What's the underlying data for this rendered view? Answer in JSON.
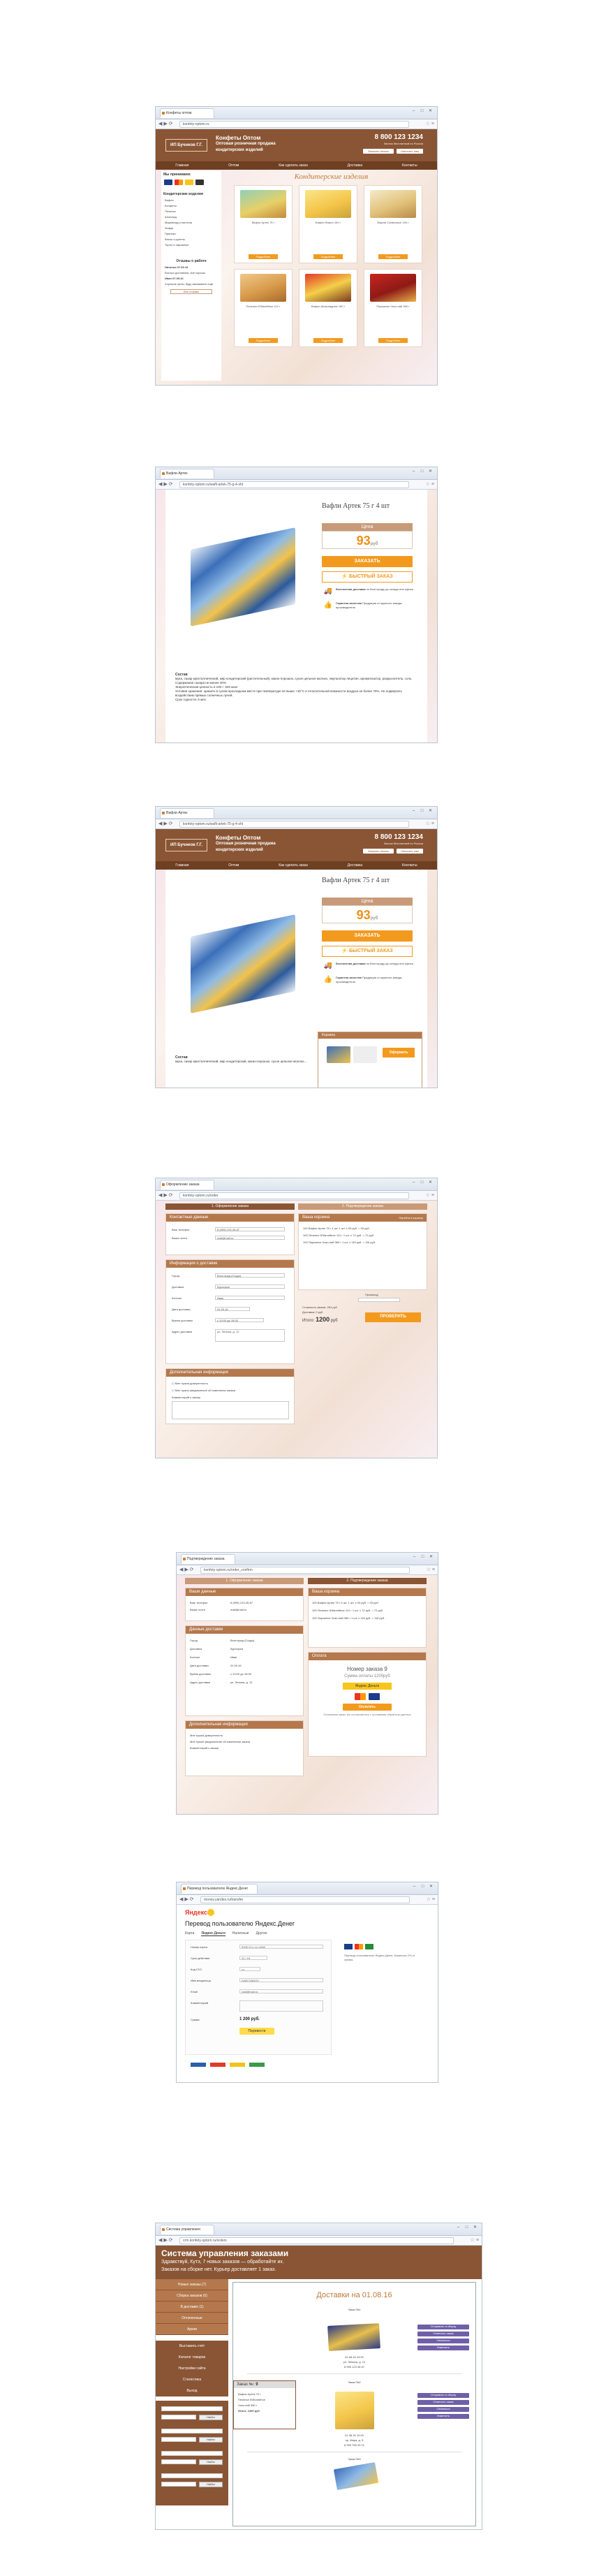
{
  "s1": {
    "tab": "Конфеты оптом",
    "url": "konfety-optom.ru",
    "logo": "ИП Бучнеов Г.Г.",
    "tagline1": "Конфеты Оптом",
    "tagline2": "Оптовая розничная продажа",
    "tagline3": "кондитерских изделий",
    "phone": "8 800 123 1234",
    "phone_sub": "Звонок бесплатный по России",
    "btn_callback": "Заказать звонок",
    "btn_mail": "Написать нам",
    "menu": [
      "Главная",
      "Оптом",
      "Как сделать заказ",
      "Доставка",
      "Контакты"
    ],
    "section_title": "Кондитерские изделия",
    "sidebar_head": "Мы принимаем:",
    "categories_head": "Кондитерские изделия",
    "categories": [
      "Вафли",
      "Конфеты",
      "Печенье",
      "Шоколад",
      "Мармелад и пастила",
      "Зефир",
      "Пряники",
      "Кексы и рулеты",
      "Торты и пирожные"
    ],
    "reviews_head": "Отзывы о работе",
    "reviews": [
      "Наталья 07.09.16",
      "Быстро доставили, всё хорошо",
      "Иван 07.09.16",
      "Хорошие цены, буду заказывать ещё"
    ],
    "all_reviews": "Все отзывы",
    "products": [
      {
        "name": "Вафли Артек 75 г",
        "price": "Подробнее"
      },
      {
        "name": "Вафли Лимон 100 г",
        "price": "Подробнее"
      },
      {
        "name": "Вафли Сливочные 100 г",
        "price": "Подробнее"
      },
      {
        "name": "Печенье Юбилейное 112 г",
        "price": "Подробнее"
      },
      {
        "name": "Вафли Шоколадные 150 г",
        "price": "Подробнее"
      },
      {
        "name": "Пирожное Чоко-пай 360 г",
        "price": "Подробнее"
      }
    ]
  },
  "s2": {
    "tab": "Вафли Артек",
    "url": "konfety-optom.ru/wafli-artek-75-g-4-sht",
    "title": "Вафли Артек 75 г 4 шт",
    "price_label": "Цена",
    "price": "93",
    "currency": "руб",
    "order": "ЗАКАЗАТЬ",
    "quick": "БЫСТРЫЙ ЗАКАЗ",
    "feat1_head": "Бесплатная доставка",
    "feat1": "по Волгограду до склада или офиса",
    "feat2_head": "Гарантия качества",
    "feat2": "Продукция от крупного завода-производителя",
    "comp_head": "Состав",
    "comp": "мука, сахар кристаллический, жир кондитерский (растительный), какао-порошок, сухое цельное молоко, эмульгатор лецитин, ароматизатор, разрыхлитель, соль. Содержание сахара не менее 40%.",
    "energy": "Энергетическая ценность в 100 г: 540 ккал",
    "storage": "Условия хранения: хранить в сухом прохладном месте при температуре не выше +18°С и относительной влажности воздуха не более 70%. Не подвергать воздействию прямых солнечных лучей.",
    "shelf": "Срок годности: 6 мес."
  },
  "s3": {
    "tab": "Вафли Артек",
    "url": "konfety-optom.ru/wafli-artek-75-g-4-sht",
    "title": "Вафли Артек 75 г 4 шт",
    "price_label": "Цена",
    "price": "93",
    "currency": "руб",
    "order": "ЗАКАЗАТЬ",
    "quick": "БЫСТРЫЙ ЗАКАЗ",
    "feat1_head": "Бесплатная доставка",
    "feat1": "по Волгограду до склада или офиса",
    "feat2_head": "Гарантия качества",
    "feat2": "Продукция от крупного завода-производителя",
    "comp_head": "Состав",
    "comp": "мука, сахар кристаллический, жир кондитерский, какао-порошок, сухое цельное молоко...",
    "cart_label": "Корзина",
    "cart_btn": "Оформить"
  },
  "s4": {
    "tab": "Оформление заказа",
    "url": "konfety-optom.ru/order",
    "stage1": "1. Оформление заказа",
    "stage2": "2. Подтверждение заказа",
    "contact_head": "Контактные данные",
    "contact_fields": [
      {
        "label": "Ваш телефон",
        "value": "8 (999) 123-45-67"
      },
      {
        "label": "Ваша почта",
        "value": "mail@mail.ru"
      }
    ],
    "delivery_head": "Информация о доставке",
    "delivery_fields": [
      {
        "label": "Город",
        "value": "Волгоград (Ссуда)"
      },
      {
        "label": "Доставка",
        "value": "Курьером"
      },
      {
        "label": "Контакт",
        "value": "Иван"
      },
      {
        "label": "Дата доставки",
        "value": "01.09.16"
      },
      {
        "label": "Время доставки",
        "value": "с 10:00  до 18:00"
      },
      {
        "label": "Адрес доставки",
        "value": "ул. Ленина, д. 12"
      }
    ],
    "extra_head": "Дополнительная информация",
    "extra_items": [
      "Мне нужна доверенность",
      "Мне нужно уведомление об изменении заказа"
    ],
    "comment_label": "Комментарий к заказу",
    "cart_head": "Ваша корзина",
    "cart_link": "Перейти в корзину",
    "cart_items": [
      "100 Вафли Артек 75 г 4 шт. 1 шт. х 93 руб. = 93 руб.",
      "100 Печенье Юбилейное 112 г 1 шт. х 72 руб. = 72 руб.",
      "100 Пирожное Чоко-пай 360 г 1 шт. х 116 руб. = 116 руб."
    ],
    "promo_label": "Промокод",
    "sum_label": "Стоимость заказа:",
    "sum_value": "281 руб",
    "delivery_label": "Доставка:",
    "delivery_value": "0 руб",
    "total_label": "Итого:",
    "total": "1200",
    "total_cur": "руб",
    "check": "ПРОВЕРИТЬ"
  },
  "s5": {
    "tab": "Подтверждение заказа",
    "url": "konfety-optom.ru/order_confirm",
    "stage1": "1. Оформление заказа",
    "stage2": "2. Подтверждение заказа",
    "contact_head": "Ваши данные",
    "delivery_head": "Данные доставки",
    "extra_head": "Дополнительная информация",
    "cart_head": "Ваша корзина",
    "pay_head": "Оплата",
    "order_no": "Номер заказа 9",
    "sum_text": "Сумма оплаты 1200руб",
    "ym": "Яндекс Деньги",
    "pay_btn": "Оплатить",
    "note": "Оплачивая заказ, вы соглашаетесь с условиями обработки данных"
  },
  "s6": {
    "tab": "Перевод пользователю Яндекс.Денег",
    "url": "money.yandex.ru/transfer",
    "brand": "Яндекс",
    "title": "Перевод пользователю Яндекс.Денег",
    "tabs": [
      "Карта",
      "Яндекс.Деньги",
      "Наличные",
      "Другие"
    ],
    "fields": [
      {
        "label": "Номер карты",
        "value": "5106 21•• •••• 4480"
      },
      {
        "label": "Срок действия",
        "value": "11 / 18"
      },
      {
        "label": "Код CVC",
        "value": "•••"
      },
      {
        "label": "Имя владельца",
        "value": "IVAN IVANOV"
      },
      {
        "label": "Email",
        "value": "mail@mail.ru"
      },
      {
        "label": "Комментарий",
        "value": ""
      }
    ],
    "sum_label": "Сумма",
    "sum": "1 200 руб.",
    "pay": "Перевести",
    "side": "Перевод пользователю Яндекс.Денег. Комиссия 2% от суммы."
  },
  "s7": {
    "tab": "Система управления",
    "url": "crm.konfety-optom.ru/orders",
    "title": "Система управления заказами",
    "sub1": "Здравствуй, Кутэ, 7 новых заказов — обработайте их.",
    "sub2": "Заказов на сборке нет. Курьер доставляет 1 заказ.",
    "nav": [
      "Новые заказы (7)",
      "Сборка заказов (0)",
      "В доставке (1)",
      "Оплаченные",
      "Архив",
      "Выставить счёт",
      "Каталог товаров",
      "Настройки сайта",
      "Статистика",
      "Выход"
    ],
    "filter_btn": "Найти",
    "main_title": "Доставки на 01.08.16",
    "orders": [
      {
        "label": "Заказ №1",
        "lines": [
          "01.08.16 10:00",
          "ул. Ленина, д. 12",
          "8 999 123 45 67"
        ],
        "buttons": [
          "Отправить в сборку",
          "Отменить заказ",
          "Связаться",
          "Изменить"
        ]
      },
      {
        "label": "Заказ №2",
        "lines": [
          "01.08.16 12:00",
          "пр. Мира, д. 5",
          "8 999 765 43 21"
        ],
        "buttons": [
          "Отправить в сборку",
          "Отменить заказ",
          "Связаться",
          "Изменить"
        ]
      },
      {
        "label": "Заказ №3",
        "lines": [
          "01.08.16 14:00"
        ],
        "buttons": []
      }
    ],
    "popup_label": "Заказ №:",
    "popup_no": "9",
    "popup_lines": [
      "Вафли Артек 75 г",
      "Печенье Юбилейное",
      "Чоко-пай 360 г",
      "Итого: 1200 руб"
    ]
  }
}
